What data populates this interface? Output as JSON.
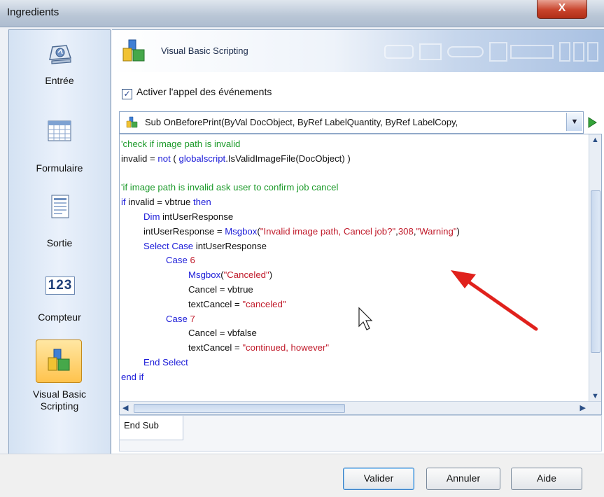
{
  "window": {
    "title": "Ingredients",
    "close_glyph": "X"
  },
  "sidebar": {
    "items": [
      {
        "label": "Entrée",
        "icon": "keyboard-icon"
      },
      {
        "label": "Formulaire",
        "icon": "form-grid-icon"
      },
      {
        "label": "Sortie",
        "icon": "document-icon"
      },
      {
        "label": "Compteur",
        "icon": "counter-icon",
        "icon_text": "123"
      },
      {
        "label": "Visual Basic Scripting",
        "label_line1": "Visual Basic",
        "label_line2": "Scripting",
        "icon": "vbscript-blocks-icon",
        "selected": true
      }
    ]
  },
  "header": {
    "title": "Visual Basic Scripting"
  },
  "options": {
    "enable_events_label": "Activer l'appel des événements",
    "enable_events_checked": true
  },
  "event_combo": {
    "value": "Sub OnBeforePrint(ByVal DocObject, ByRef LabelQuantity, ByRef LabelCopy,"
  },
  "code": {
    "lines": [
      {
        "indent": 0,
        "parts": [
          {
            "t": "'check if image path is invalid",
            "c": "cm"
          }
        ]
      },
      {
        "indent": 0,
        "parts": [
          {
            "t": "invalid = ",
            "c": "tx"
          },
          {
            "t": "not",
            "c": "kw"
          },
          {
            "t": " ( ",
            "c": "tx"
          },
          {
            "t": "globalscript",
            "c": "kw"
          },
          {
            "t": ".IsValidImageFile(DocObject) )",
            "c": "tx"
          }
        ]
      },
      {
        "indent": 0,
        "parts": []
      },
      {
        "indent": 0,
        "parts": [
          {
            "t": "'if image path is invalid ask user to confirm job cancel",
            "c": "cm"
          }
        ]
      },
      {
        "indent": 0,
        "parts": [
          {
            "t": "if",
            "c": "kw"
          },
          {
            "t": " invalid = vbtrue ",
            "c": "tx"
          },
          {
            "t": "then",
            "c": "kw"
          }
        ]
      },
      {
        "indent": 1,
        "parts": [
          {
            "t": "Dim",
            "c": "kw"
          },
          {
            "t": " intUserResponse",
            "c": "tx"
          }
        ]
      },
      {
        "indent": 1,
        "parts": [
          {
            "t": "intUserResponse = ",
            "c": "tx"
          },
          {
            "t": "Msgbox",
            "c": "kw"
          },
          {
            "t": "(",
            "c": "tx"
          },
          {
            "t": "\"Invalid image path, Cancel job?\"",
            "c": "str"
          },
          {
            "t": ",",
            "c": "tx"
          },
          {
            "t": "308",
            "c": "str"
          },
          {
            "t": ",",
            "c": "tx"
          },
          {
            "t": "\"Warning\"",
            "c": "str"
          },
          {
            "t": ")",
            "c": "tx"
          }
        ]
      },
      {
        "indent": 1,
        "parts": [
          {
            "t": "Select Case",
            "c": "kw"
          },
          {
            "t": " intUserResponse",
            "c": "tx"
          }
        ]
      },
      {
        "indent": 2,
        "parts": [
          {
            "t": "Case",
            "c": "kw"
          },
          {
            "t": " ",
            "c": "tx"
          },
          {
            "t": "6",
            "c": "str"
          }
        ]
      },
      {
        "indent": 3,
        "parts": [
          {
            "t": "Msgbox",
            "c": "kw"
          },
          {
            "t": "(",
            "c": "tx"
          },
          {
            "t": "\"Canceled\"",
            "c": "str"
          },
          {
            "t": ")",
            "c": "tx"
          }
        ]
      },
      {
        "indent": 3,
        "parts": [
          {
            "t": "Cancel = vbtrue",
            "c": "tx"
          }
        ]
      },
      {
        "indent": 3,
        "parts": [
          {
            "t": "textCancel = ",
            "c": "tx"
          },
          {
            "t": "\"canceled\"",
            "c": "str"
          }
        ]
      },
      {
        "indent": 2,
        "parts": [
          {
            "t": "Case",
            "c": "kw"
          },
          {
            "t": " ",
            "c": "tx"
          },
          {
            "t": "7",
            "c": "str"
          }
        ]
      },
      {
        "indent": 3,
        "parts": [
          {
            "t": "Cancel = vbfalse",
            "c": "tx"
          }
        ]
      },
      {
        "indent": 3,
        "parts": [
          {
            "t": "textCancel = ",
            "c": "tx"
          },
          {
            "t": "\"continued, however\"",
            "c": "str"
          }
        ]
      },
      {
        "indent": 1,
        "parts": [
          {
            "t": "End Select",
            "c": "kw"
          }
        ]
      },
      {
        "indent": 0,
        "parts": [
          {
            "t": "end if",
            "c": "kw"
          }
        ]
      }
    ]
  },
  "footer_tab": {
    "label": "End Sub"
  },
  "buttons": {
    "ok": "Valider",
    "cancel": "Annuler",
    "help": "Aide"
  },
  "colors": {
    "keyword": "#1b1bd8",
    "comment": "#1c9a2a",
    "string": "#c01a2a",
    "annotation_arrow": "#e0211c"
  }
}
